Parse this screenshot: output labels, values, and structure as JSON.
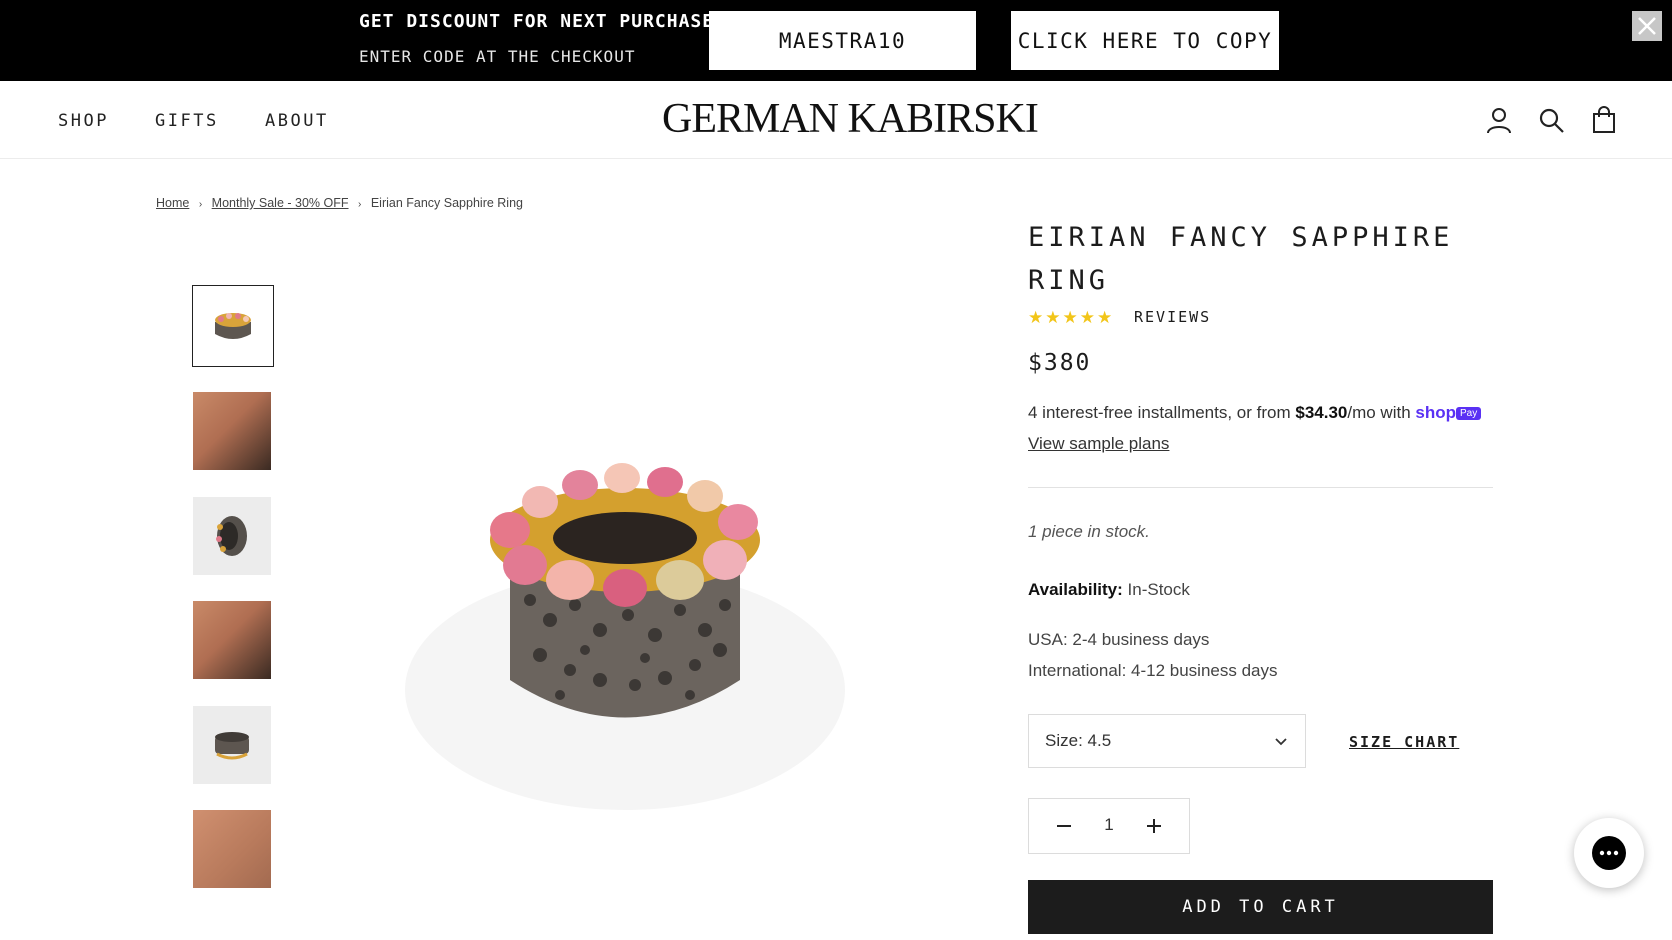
{
  "promo": {
    "headline": "GET DISCOUNT FOR NEXT PURCHASE",
    "subline": "ENTER CODE AT THE CHECKOUT",
    "code": "MAESTRA10",
    "copy_label": "CLICK HERE TO COPY"
  },
  "nav": {
    "items": [
      "SHOP",
      "GIFTS",
      "ABOUT"
    ]
  },
  "brand": "GERMAN KABIRSKI",
  "header_icons": [
    "account-icon",
    "search-icon",
    "cart-bag-icon"
  ],
  "breadcrumb": {
    "home": "Home",
    "sep": "›",
    "category": "Monthly Sale - 30% OFF",
    "current": "Eirian Fancy Sapphire Ring"
  },
  "product": {
    "title": "EIRIAN FANCY SAPPHIRE RING",
    "rating_stars": "★★★★★",
    "rating": 5,
    "reviews_label": "REVIEWS",
    "price": "$380",
    "installments_prefix": "4 interest-free installments, or from ",
    "installments_amount": "$34.30",
    "installments_suffix": "/mo with ",
    "shop_text": "shop",
    "pay_text": "Pay",
    "sample_plans": "View sample plans",
    "stock": "1 piece in stock.",
    "availability_label": "Availability:",
    "availability_value": " In-Stock",
    "shipping_usa": "USA: 2-4 business days",
    "shipping_intl": "International: 4-12 business days",
    "size_selected": "Size: 4.5",
    "size_chart": "SIZE CHART",
    "quantity": "1",
    "add_to_cart": "ADD TO CART"
  },
  "colors": {
    "promo_bg": "#000000",
    "star": "#f2c519",
    "shop_pay": "#5a31f4",
    "button_bg": "#1c1c1c"
  }
}
